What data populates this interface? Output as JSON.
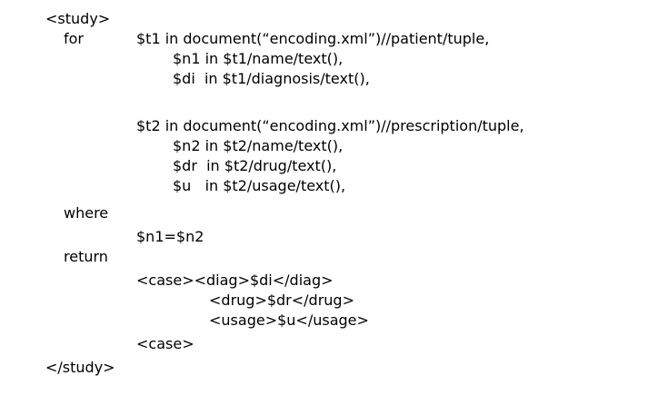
{
  "document": {
    "lines": [
      "<study>",
      "for",
      "$t1 in document(“encoding.xml”)//patient/tuple,",
      "$n1 in $t1/name/text(),",
      "$di  in $t1/diagnosis/text(),",
      "$t2 in document(“encoding.xml”)//prescription/tuple,",
      "$n2 in $t2/name/text(),",
      "$dr  in $t2/drug/text(),",
      "$u   in $t2/usage/text(),",
      "where",
      "$n1=$n2",
      "return",
      "<case><diag>$di</diag>",
      "<drug>$dr</drug>",
      "<usage>$u</usage>",
      "<case>",
      "</study>"
    ]
  }
}
